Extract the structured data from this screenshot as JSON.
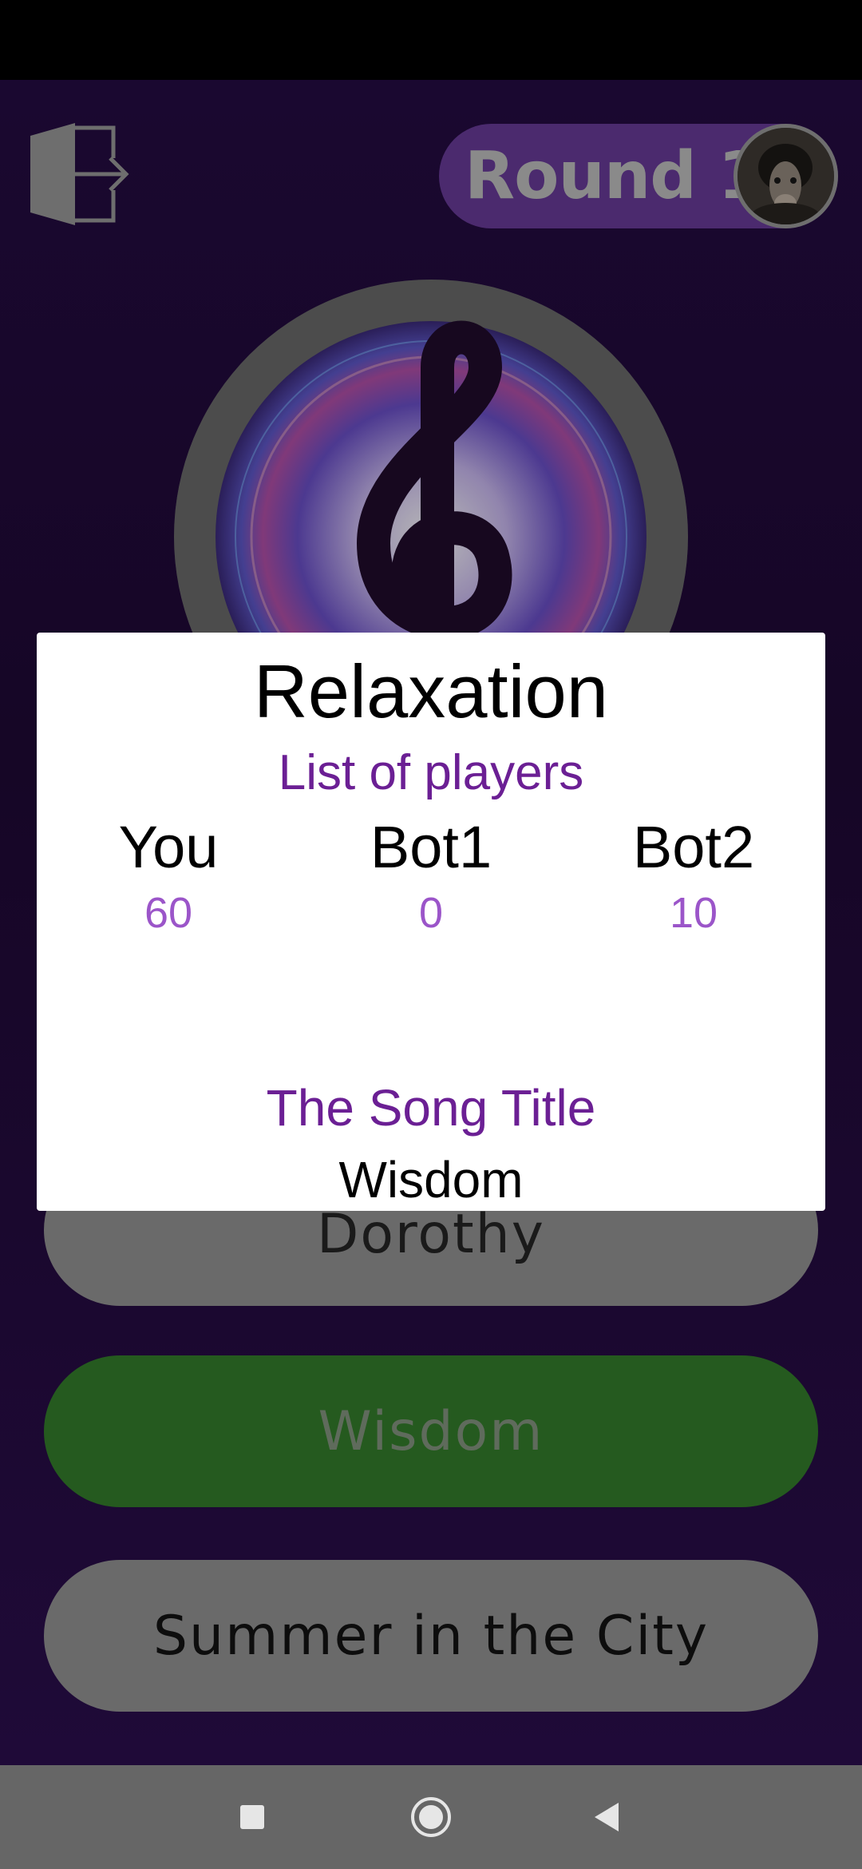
{
  "header": {
    "round_label": "Round 1"
  },
  "answers": [
    {
      "label": "Dorothy",
      "state": "neutral"
    },
    {
      "label": "Wisdom",
      "state": "correct"
    },
    {
      "label": "Summer in the City",
      "state": "neutral"
    }
  ],
  "dialog": {
    "title": "Relaxation",
    "players_heading": "List of players",
    "players": [
      {
        "name": "You",
        "score": "60"
      },
      {
        "name": "Bot1",
        "score": "0"
      },
      {
        "name": "Bot2",
        "score": "10"
      }
    ],
    "song_heading": "The Song Title",
    "song_title": "Wisdom"
  },
  "colors": {
    "accent_purple": "#6b1f94",
    "score_purple": "#9b55c9",
    "correct_green": "#255a1f"
  },
  "icons": [
    "exit-icon",
    "avatar",
    "treble-clef-icon",
    "nav-recents-icon",
    "nav-home-icon",
    "nav-back-icon"
  ]
}
